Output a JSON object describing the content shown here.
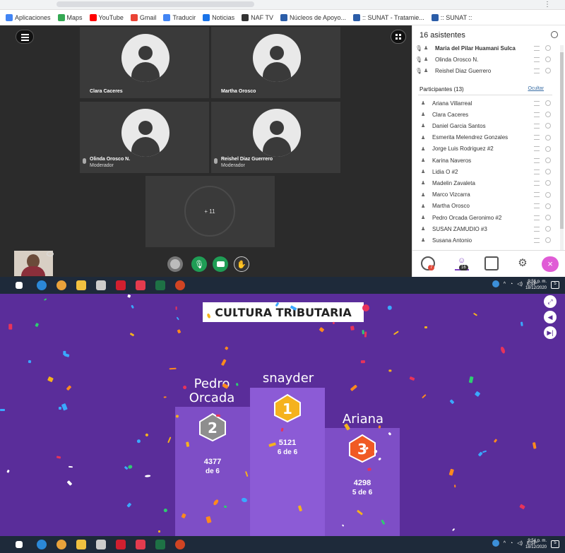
{
  "browser": {
    "bookmarks": [
      {
        "label": "Aplicaciones",
        "color": "#4285f4"
      },
      {
        "label": "Maps",
        "color": "#34a853"
      },
      {
        "label": "YouTube",
        "color": "#ff0000"
      },
      {
        "label": "Gmail",
        "color": "#ea4335"
      },
      {
        "label": "Traducir",
        "color": "#4285f4"
      },
      {
        "label": "Noticias",
        "color": "#1a73e8"
      },
      {
        "label": "NAF TV",
        "color": "#333333"
      },
      {
        "label": "Núcleos de Apoyo...",
        "color": "#2b5da8"
      },
      {
        "label": ":: SUNAT - Tratamie...",
        "color": "#2b5da8"
      },
      {
        "label": ":: SUNAT ::",
        "color": "#2b5da8"
      }
    ]
  },
  "meeting": {
    "tiles": [
      {
        "name": "Clara Caceres",
        "role": ""
      },
      {
        "name": "Martha Orosco",
        "role": ""
      },
      {
        "name": "Olinda Orosco N.",
        "role": "Moderador"
      },
      {
        "name": "Reishel Diaz Guerrero",
        "role": "Moderador"
      }
    ],
    "more_count": "+ 11"
  },
  "panel": {
    "title": "16 asistentes",
    "moderators": [
      "Maria del Pilar Huamani Sulca",
      "Olinda Orosco N.",
      "Reishel Diaz Guerrero"
    ],
    "participants_header": "Participantes (13)",
    "hide_label": "Ocultar",
    "participants": [
      "Ariana Villarreal",
      "Clara Caceres",
      "Daniel Garcia Santos",
      "Esmerita Melendrez Gonzales",
      "Jorge Luis Rodriguez #2",
      "Karina Naveros",
      "Lidia O #2",
      "Madelin Zavaleta",
      "Marco Vizcarra",
      "Martha Orosco",
      "Pedro Orcada Geronimo #2",
      "SUSAN ZAMUDIO #3",
      "Susana Antonio"
    ],
    "chat_badge": "7",
    "attendee_badge": "16"
  },
  "taskbar": {
    "top_time": "9:56 p. m.",
    "top_date": "18/12/2020",
    "bottom_time": "9:54 p. m.",
    "bottom_date": "18/12/2020",
    "lang": "ESP",
    "notif": "5"
  },
  "game": {
    "title": "CULTURA TRIBUTARIA",
    "podium": [
      {
        "rank": "2",
        "name": "Pedro\nOrcada",
        "score": "4377",
        "correct": "de 6"
      },
      {
        "rank": "1",
        "name": "snayder",
        "score": "5121",
        "correct": "6 de 6"
      },
      {
        "rank": "3",
        "name": "Ariana",
        "score": "4298",
        "correct": "5 de 6"
      }
    ],
    "colors": {
      "background": "#5a2d9a",
      "gold": "#f5b21d",
      "silver": "#8e8e8e",
      "bronze": "#f05a24"
    }
  }
}
